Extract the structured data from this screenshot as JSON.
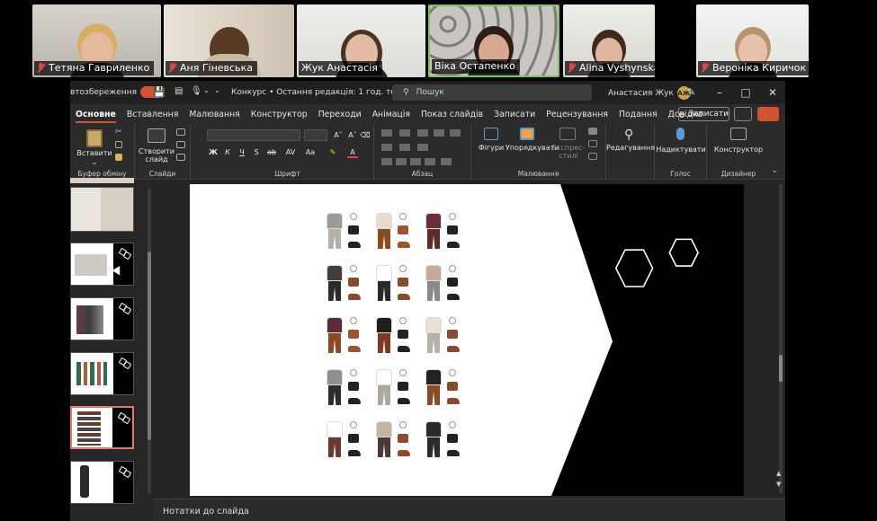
{
  "participants": [
    {
      "name": "Тетяна Гавриленко",
      "muted": true
    },
    {
      "name": "Аня Гіневська",
      "muted": true
    },
    {
      "name": "Жук Анастасія",
      "muted": false
    },
    {
      "name": "Віка Остапенко",
      "muted": false
    },
    {
      "name": "Alina Vyshynska",
      "muted": true
    },
    {
      "name": "Вероніка Киричок",
      "muted": true
    }
  ],
  "titlebar": {
    "autosave_label": "втозбереження",
    "doc_title": "Конкурс • Остання редакція: 1 год. тому",
    "search_placeholder": "Пошук",
    "user_name": "Анастасия Жук",
    "user_initials": "АЖ"
  },
  "menu": {
    "tabs": [
      "Основне",
      "Вставлення",
      "Малювання",
      "Конструктор",
      "Переходи",
      "Анімація",
      "Показ слайдів",
      "Записати",
      "Рецензування",
      "Подання",
      "Довідка"
    ],
    "active_tab": "Основне",
    "record_button": "Записати"
  },
  "ribbon": {
    "paste_label": "Вставити",
    "clipboard_group": "Буфер обміну",
    "new_slide_label": "Створити\nслайд",
    "slides_group": "Слайди",
    "font_group": "Шрифт",
    "paragraph_group": "Абзац",
    "shapes_label": "Фігури",
    "arrange_label": "Упорядкувати",
    "quick_styles_label": "Експрес-\nстилі",
    "drawing_group": "Малювання",
    "editing_label": "Редагування",
    "dictate_label": "Надиктувати",
    "voice_group": "Голос",
    "designer_label": "Конструктор",
    "designer_group": "Дизайнер"
  },
  "notes_placeholder": "Нотатки до слайда",
  "colors": {
    "accent": "#d35230",
    "selected_thumb_border": "#e07b60",
    "window_bg": "#2b2b2b"
  }
}
